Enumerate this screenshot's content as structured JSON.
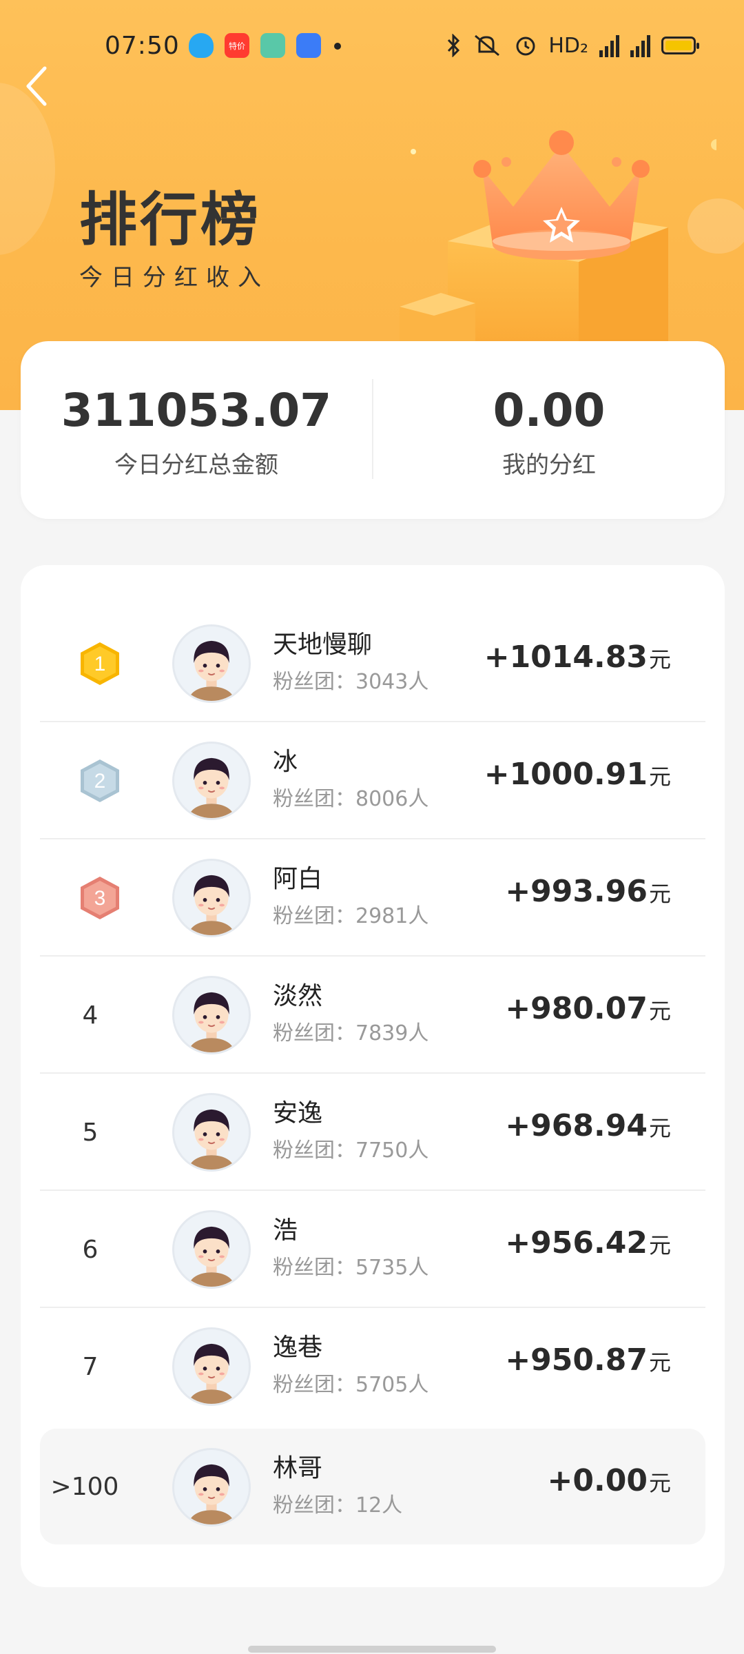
{
  "status_bar": {
    "time": "07:50",
    "tmall_label": "特价",
    "network_label": "HD₂"
  },
  "header": {
    "title": "排行榜",
    "subtitle": "今日分红收入"
  },
  "summary": {
    "total_value": "311053.07",
    "total_label": "今日分红总金额",
    "mine_value": "0.00",
    "mine_label": "我的分红"
  },
  "ranking": {
    "currency_unit": "元",
    "fans_prefix": "粉丝团：",
    "rows": [
      {
        "rank": "1",
        "name": "天地慢聊",
        "fans": "粉丝团：3043人",
        "amount": "+1014.83",
        "unit": "元"
      },
      {
        "rank": "2",
        "name": "冰",
        "fans": "粉丝团：8006人",
        "amount": "+1000.91",
        "unit": "元"
      },
      {
        "rank": "3",
        "name": "阿白",
        "fans": "粉丝团：2981人",
        "amount": "+993.96",
        "unit": "元"
      },
      {
        "rank": "4",
        "name": "淡然",
        "fans": "粉丝团：7839人",
        "amount": "+980.07",
        "unit": "元"
      },
      {
        "rank": "5",
        "name": "安逸",
        "fans": "粉丝团：7750人",
        "amount": "+968.94",
        "unit": "元"
      },
      {
        "rank": "6",
        "name": "浩",
        "fans": "粉丝团：5735人",
        "amount": "+956.42",
        "unit": "元"
      },
      {
        "rank": "7",
        "name": "逸巷",
        "fans": "粉丝团：5705人",
        "amount": "+950.87",
        "unit": "元"
      }
    ],
    "mine": {
      "rank": ">100",
      "name": "林哥",
      "fans": "粉丝团：12人",
      "amount": "+0.00",
      "unit": "元"
    }
  },
  "colors": {
    "header_bg": "#fdb94d",
    "gold": "#f8b500",
    "silver": "#b9d0dd",
    "bronze": "#eb8d7f"
  }
}
